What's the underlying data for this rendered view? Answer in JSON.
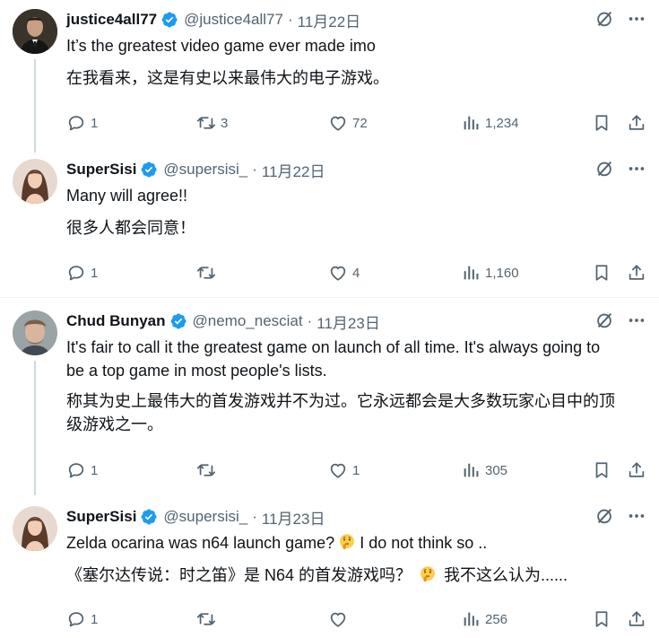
{
  "tweets": [
    {
      "name": "justice4all77",
      "handle": "@justice4all77",
      "date": "11月22日",
      "text": "It’s the greatest video game ever made imo",
      "translation": "在我看来，这是有史以来最伟大的电子游戏。",
      "replies": "1",
      "retweets": "3",
      "likes": "72",
      "views": "1,234"
    },
    {
      "name": "SuperSisi",
      "handle": "@supersisi_",
      "date": "11月22日",
      "text": "Many will agree!!",
      "translation": "很多人都会同意！",
      "replies": "1",
      "retweets": "",
      "likes": "4",
      "views": "1,160"
    },
    {
      "name": "Chud Bunyan",
      "handle": "@nemo_nesciat",
      "date": "11月23日",
      "text_line1": "It's fair to call it the greatest game on launch of all time. It's always going to",
      "text_line2": "be a top game in most people's lists.",
      "translation_line1": "称其为史上最伟大的首发游戏并不为过。它永远都会是大多数玩家心目中的顶",
      "translation_line2": "级游戏之一。",
      "replies": "1",
      "retweets": "",
      "likes": "1",
      "views": "305"
    },
    {
      "name": "SuperSisi",
      "handle": "@supersisi_",
      "date": "11月23日",
      "text_before": "Zelda ocarina  was n64 launch game?",
      "text_after": "I do not think so ..",
      "translation_before": "《塞尔达传说：时之笛》是 N64 的首发游戏吗？",
      "translation_after": "我不这么认为......",
      "replies": "1",
      "retweets": "",
      "likes": "",
      "views": "256"
    }
  ],
  "dot": "·",
  "icons": {
    "verified": "verified-badge-icon",
    "grok": "grok-icon",
    "more": "more-icon",
    "reply": "reply-icon",
    "retweet": "retweet-icon",
    "like": "heart-icon",
    "views": "views-icon",
    "bookmark": "bookmark-icon",
    "share": "share-icon",
    "thinking": "thinking-face-emoji"
  },
  "colors": {
    "verified": "#1d9bf0",
    "text": "#0f1419",
    "secondary": "#536471",
    "divider": "#eff3f4",
    "thread_line": "#cfd9de"
  }
}
